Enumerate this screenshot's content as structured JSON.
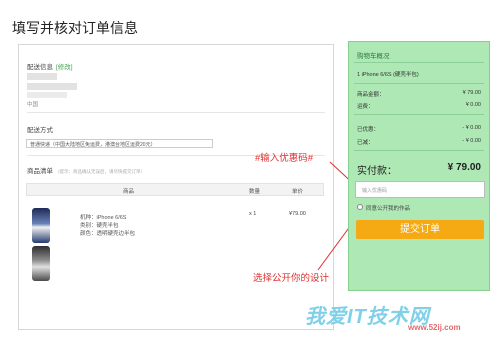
{
  "page": {
    "title": "填写并核对订单信息"
  },
  "address": {
    "label": "配送信息",
    "edit": "[修改]",
    "region": "中国"
  },
  "shipping": {
    "label": "配送方式",
    "option": "普通快递（中国大陆地区免运费，港澳台地区运费20元）"
  },
  "products": {
    "label": "商品清单",
    "note": "（提示：商品确认无误后，请尽快提交订单）",
    "headers": {
      "name": "商品",
      "qty": "数量",
      "price": "单价"
    },
    "item": {
      "model": "机种：iPhone 6/6S",
      "type": "类别：硬壳半包",
      "color": "颜色：透明硬壳边半包",
      "qty": "x 1",
      "price": "¥79.00"
    }
  },
  "annotations": {
    "coupon": "#输入优惠码#",
    "public": "选择公开你的设计"
  },
  "cart": {
    "title": "购物车概况",
    "item": "1 iPhone 6/6S (硬壳半包)",
    "amount_label": "商品金额：",
    "amount_value": "¥ 79.00",
    "freight_label": "运费：",
    "freight_value": "¥ 0.00",
    "discount_label": "已优惠：",
    "discount_value": "- ¥ 0.00",
    "reduce_label": "已减：",
    "reduce_value": "- ¥ 0.00",
    "total_label": "实付款：",
    "total_value": "¥ 79.00",
    "coupon_placeholder": "输入优惠码",
    "public_label": "同意公开我的作品",
    "submit": "提交订单"
  },
  "watermark": {
    "main": "我爱IT技术网",
    "sub": "www.52ij.com"
  },
  "colors": {
    "summary_bg": "#aee8b4",
    "submit": "#f5a913",
    "annotation": "#e03030"
  }
}
